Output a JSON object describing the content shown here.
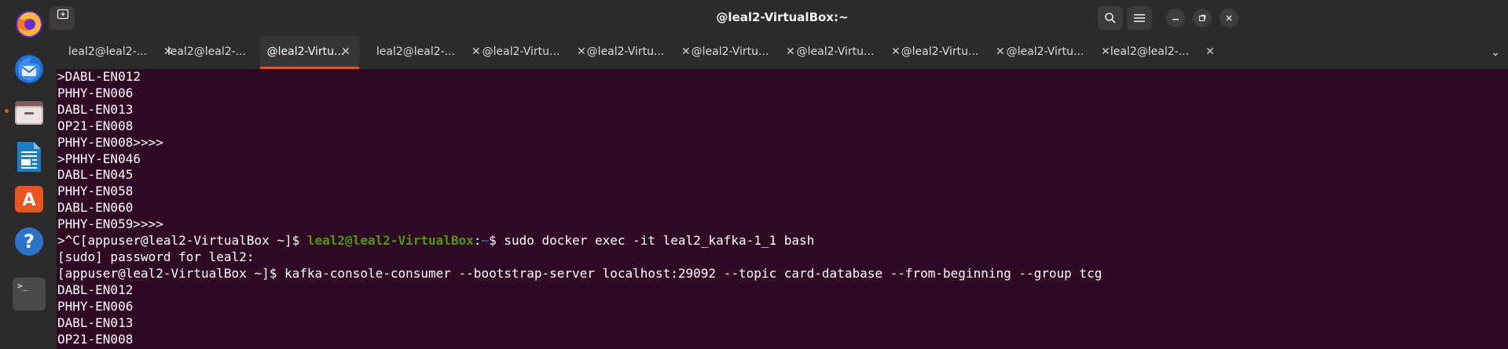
{
  "window": {
    "title": "@leal2-VirtualBox:~"
  },
  "dock": {
    "items": [
      {
        "name": "firefox-icon"
      },
      {
        "name": "thunderbird-icon"
      },
      {
        "name": "files-icon"
      },
      {
        "name": "libreoffice-writer-icon"
      },
      {
        "name": "app-center-icon"
      },
      {
        "name": "help-icon"
      },
      {
        "name": "terminal-icon",
        "glyph": ">_"
      }
    ]
  },
  "tabs": [
    {
      "label": "leal2@leal2-...",
      "close": "✕",
      "active": false
    },
    {
      "label": "leal2@leal2-...",
      "close": "✕",
      "active": false
    },
    {
      "label": "@leal2-Virtu...",
      "close": "✕",
      "active": true
    },
    {
      "label": "leal2@leal2-...",
      "close": "✕",
      "active": false
    },
    {
      "label": "@leal2-Virtu...",
      "close": "✕",
      "active": false
    },
    {
      "label": "@leal2-Virtu...",
      "close": "✕",
      "active": false
    },
    {
      "label": "@leal2-Virtu...",
      "close": "✕",
      "active": false
    },
    {
      "label": "@leal2-Virtu...",
      "close": "✕",
      "active": false
    },
    {
      "label": "@leal2-Virtu...",
      "close": "✕",
      "active": false
    },
    {
      "label": "@leal2-Virtu...",
      "close": "✕",
      "active": false
    },
    {
      "label": "leal2@leal2-...",
      "close": "✕",
      "active": false
    }
  ],
  "tab_menu": "⌄",
  "terminal": {
    "lines": [
      ">DABL-EN012",
      "PHHY-EN006",
      "DABL-EN013",
      "OP21-EN008",
      "PHHY-EN008>>>>",
      ">PHHY-EN046",
      "DABL-EN045",
      "PHHY-EN058",
      "DABL-EN060",
      "PHHY-EN059>>>>"
    ],
    "prompt_line": {
      "prefix": ">^C[appuser@leal2-VirtualBox ~]$ ",
      "user_host": "leal2@leal2-VirtualBox",
      "colon": ":",
      "path": "~",
      "dollar": "$ ",
      "command": "sudo docker exec -it leal2_kafka-1_1 bash"
    },
    "lines_after": [
      "[sudo] password for leal2:",
      "[appuser@leal2-VirtualBox ~]$ kafka-console-consumer --bootstrap-server localhost:29092 --topic card-database --from-beginning --group tcg",
      "DABL-EN012",
      "PHHY-EN006",
      "DABL-EN013",
      "OP21-EN008"
    ]
  }
}
